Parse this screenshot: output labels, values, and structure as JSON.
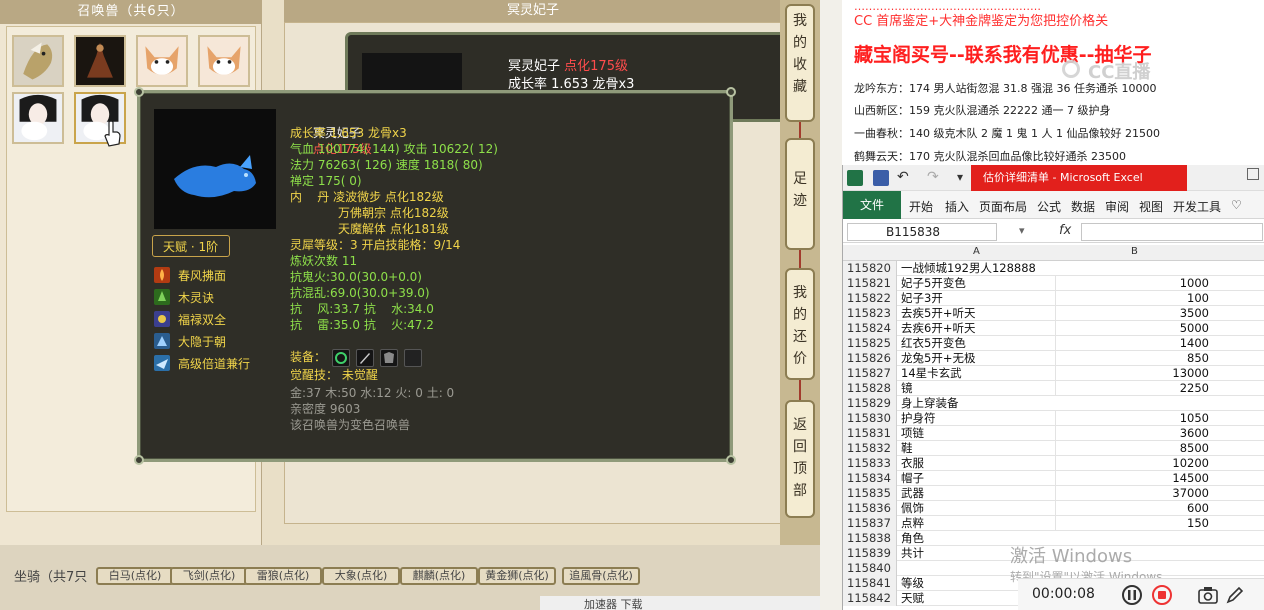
{
  "left_panel": {
    "title": "召唤兽（共6只）"
  },
  "center": {
    "title": "冥灵妃子",
    "back_card_name": "冥灵妃子",
    "back_card_level": "点化175级",
    "back_card_growth": "成长率 1.653 龙骨x3"
  },
  "vertical_tabs": [
    {
      "label": "我的收藏",
      "chars": [
        "我",
        "的",
        "收",
        "藏"
      ]
    },
    {
      "label": "足迹",
      "chars": [
        "足",
        "迹"
      ]
    },
    {
      "label": "我的还价",
      "chars": [
        "我",
        "的",
        "还",
        "价"
      ]
    },
    {
      "label": "返回顶部",
      "chars": [
        "返",
        "回",
        "顶",
        "部"
      ]
    }
  ],
  "tooltip": {
    "name": "冥灵妃子",
    "level": "点化175级",
    "growth": "成长率 1.653 龙骨x3",
    "hp_attack": "气血 100174( 144) 攻击 10622( 12)",
    "mp_speed": "法力 76263( 126) 速度 1818( 80)",
    "focus": "禅定 175( 0)",
    "inner1": "内    丹 凌波微步 点化182级",
    "inner2": "万佛朝宗 点化182级",
    "inner3": "天魔解体 点化181级",
    "spirit": "灵犀等级：3 开启技能格：9/14",
    "refine": "炼妖次数 11",
    "resist1": "抗鬼火:30.0(30.0+0.0)",
    "resist2": "抗混乱:69.0(30.0+39.0)",
    "resist3": "抗    风:33.7 抗    水:34.0",
    "resist4": "抗    雷:35.0 抗    火:47.2",
    "equip_label": "装备：",
    "awaken": "觉醒技： 未觉醒",
    "elements": "金:37 木:50 水:12 火: 0 土: 0",
    "intimacy": "亲密度 9603",
    "note": "该召唤兽为变色召唤兽",
    "talent": "天赋 · 1阶",
    "skills": [
      "春风拂面",
      "木灵诀",
      "福禄双全",
      "大隐于朝",
      "高级倍道兼行"
    ]
  },
  "bottom": {
    "label": "坐骑（共7只",
    "tabs": [
      "白马(点化)",
      "飞剑(点化)",
      "雷狼(点化)",
      "大象(点化)",
      "麒麟(点化)",
      "黄金狮(点化)",
      "追風骨(点化)"
    ],
    "status": "加速器    下载"
  },
  "article": {
    "top_line": "……………………………………………",
    "cc_line": "CC 首席鉴定+大神金牌鉴定为您把控价格关",
    "headline": "藏宝阁买号--联系我有优惠--抽华子",
    "rows": [
      "龙吟东方：174 男人站街忽混 31.8 强混 36 任务通杀 10000",
      "山西新区：159 克火队混通杀 22222 通一 7 级护身",
      "一曲春秋：140 级克木队 2 魔 1 鬼 1 人 1 仙品像较好 21500",
      "鹤舞云天：170 克火队混杀回血品像比较好通杀 23500"
    ],
    "watermark": "CC直播"
  },
  "excel": {
    "window_title": "估价详细清单 - Microsoft Excel",
    "file_tab": "文件",
    "menus": [
      "开始",
      "插入",
      "页面布局",
      "公式",
      "数据",
      "审阅",
      "视图",
      "开发工具"
    ],
    "name_box": "B115838",
    "fx": "fx",
    "col_a": "A",
    "col_b": "B",
    "rows": [
      {
        "n": "115820",
        "a": "一战倾城192男人128888",
        "b": ""
      },
      {
        "n": "115821",
        "a": "妃子5开变色",
        "b": "1000"
      },
      {
        "n": "115822",
        "a": "妃子3开",
        "b": "100"
      },
      {
        "n": "115823",
        "a": "去疾5开+听天",
        "b": "3500"
      },
      {
        "n": "115824",
        "a": "去疾6开+听天",
        "b": "5000"
      },
      {
        "n": "115825",
        "a": "红衣5开变色",
        "b": "1400"
      },
      {
        "n": "115826",
        "a": "龙兔5开+无极",
        "b": "850"
      },
      {
        "n": "115827",
        "a": "14星卡玄武",
        "b": "13000"
      },
      {
        "n": "115828",
        "a": "镜",
        "b": "2250"
      },
      {
        "n": "115829",
        "a": "身上穿装备",
        "b": ""
      },
      {
        "n": "115830",
        "a": "护身符",
        "b": "1050"
      },
      {
        "n": "115831",
        "a": "项链",
        "b": "3600"
      },
      {
        "n": "115832",
        "a": "鞋",
        "b": "8500"
      },
      {
        "n": "115833",
        "a": "衣服",
        "b": "10200"
      },
      {
        "n": "115834",
        "a": "帽子",
        "b": "14500"
      },
      {
        "n": "115835",
        "a": "武器",
        "b": "37000"
      },
      {
        "n": "115836",
        "a": "佩饰",
        "b": "600"
      },
      {
        "n": "115837",
        "a": "点粹",
        "b": "150"
      },
      {
        "n": "115838",
        "a": "角色",
        "b": ""
      },
      {
        "n": "115839",
        "a": "共计",
        "b": ""
      },
      {
        "n": "115840",
        "a": "",
        "b": ""
      },
      {
        "n": "115841",
        "a": "等级",
        "b": ""
      },
      {
        "n": "115842",
        "a": "天赋",
        "b": ""
      }
    ],
    "activate_title": "激活 Windows",
    "activate_sub": "转到\"设置\"以激活 Windows。"
  },
  "recorder": {
    "time": "00:00:08"
  }
}
